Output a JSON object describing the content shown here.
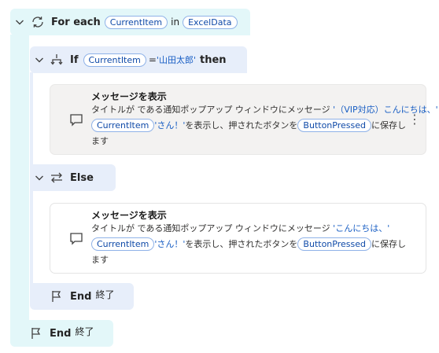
{
  "foreach": {
    "keyword": "For each",
    "item_var": "CurrentItem",
    "in_label": "in",
    "collection_var": "ExcelData",
    "end_label": "End",
    "end_sub": "終了"
  },
  "if_block": {
    "keyword": "If",
    "var": "CurrentItem",
    "operator": "=",
    "value": "'山田太郎'",
    "then_label": "then",
    "else_label": "Else",
    "end_label": "End",
    "end_sub": "終了"
  },
  "action1": {
    "title": "メッセージを表示",
    "line1_prefix": "タイトルが  である通知ポップアップ ウィンドウにメッセージ",
    "line1_literal": " '（VIP対応）こんにちは、'",
    "var_item": "CurrentItem",
    "line2_literal": "'さん！'",
    "line2_mid": " を表示し、押されたボタンを ",
    "var_button": "ButtonPressed",
    "line2_suffix": " に保存し",
    "line3": "ます",
    "menu_glyph": "⋮"
  },
  "action2": {
    "title": "メッセージを表示",
    "line1_prefix": "タイトルが  である通知ポップアップ ウィンドウにメッセージ",
    "line1_literal": " 'こんにちは、'",
    "var_item": "CurrentItem",
    "line2_literal": "'さん！'",
    "line2_mid": " を表示し、押されたボタンを ",
    "var_button": "ButtonPressed",
    "line2_suffix": " に保存し",
    "line3": "ます"
  }
}
